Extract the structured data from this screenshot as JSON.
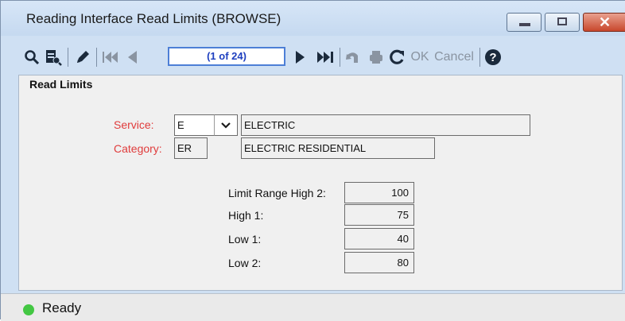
{
  "window": {
    "title": "Reading Interface Read Limits (BROWSE)",
    "controls": [
      "minimize",
      "maximize",
      "close"
    ],
    "close_color": "#c8472c"
  },
  "toolbar": {
    "icons": [
      "search-icon",
      "browse-document-icon",
      "edit-pencil-icon",
      "first-record-icon",
      "previous-record-icon",
      "next-record-icon",
      "last-record-icon",
      "undo-icon",
      "print-icon",
      "refresh-icon",
      "help-icon"
    ],
    "record_indicator": "(1 of 24)",
    "ok_label": "OK",
    "cancel_label": "Cancel"
  },
  "form": {
    "section_title": "Read Limits",
    "service": {
      "label": "Service:",
      "code": "E",
      "description": "ELECTRIC"
    },
    "category": {
      "label": "Category:",
      "code": "ER",
      "description": "ELECTRIC RESIDENTIAL"
    },
    "limits": [
      {
        "label": "Limit Range High 2:",
        "value": "100"
      },
      {
        "label": "High 1:",
        "value": "75"
      },
      {
        "label": "Low 1:",
        "value": "40"
      },
      {
        "label": "Low 2:",
        "value": "80"
      }
    ]
  },
  "status": {
    "text": "Ready",
    "color": "#43c743"
  }
}
